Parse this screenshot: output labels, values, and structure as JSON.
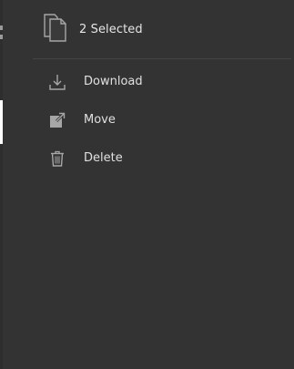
{
  "header": {
    "title": "2 Selected",
    "icon": "files-icon"
  },
  "menu": {
    "items": [
      {
        "label": "Download",
        "icon": "download-icon"
      },
      {
        "label": "Move",
        "icon": "move-icon"
      },
      {
        "label": "Delete",
        "icon": "trash-icon"
      }
    ]
  },
  "colors": {
    "panel_background": "#333333",
    "text": "#e0e0e0",
    "icon": "#a6a6a6",
    "divider": "#444444"
  }
}
